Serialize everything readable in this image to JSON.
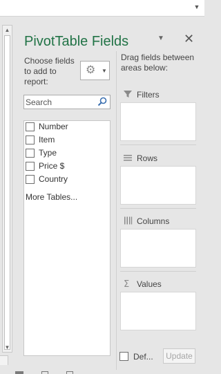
{
  "topbar": {
    "dropdown_icon": "chevron-down-icon"
  },
  "pane": {
    "title": "PivotTable Fields",
    "options_icon": "chevron-down-icon",
    "close_icon": "close-icon",
    "choose_label": "Choose fields to add to report:",
    "tools_icon": "gear-icon",
    "search_placeholder": "Search",
    "fields": [
      {
        "label": "Number",
        "checked": false
      },
      {
        "label": "Item",
        "checked": false
      },
      {
        "label": "Type",
        "checked": false
      },
      {
        "label": "Price $",
        "checked": false
      },
      {
        "label": "Country",
        "checked": false
      }
    ],
    "more_tables": "More Tables...",
    "drag_label": "Drag fields between areas below:",
    "areas": {
      "filters": "Filters",
      "rows": "Rows",
      "columns": "Columns",
      "values": "Values"
    },
    "defer_label": "Def...",
    "update_label": "Update"
  },
  "colors": {
    "title": "#217346",
    "pane_bg": "#e6e6e6",
    "box_bg": "#ffffff"
  }
}
